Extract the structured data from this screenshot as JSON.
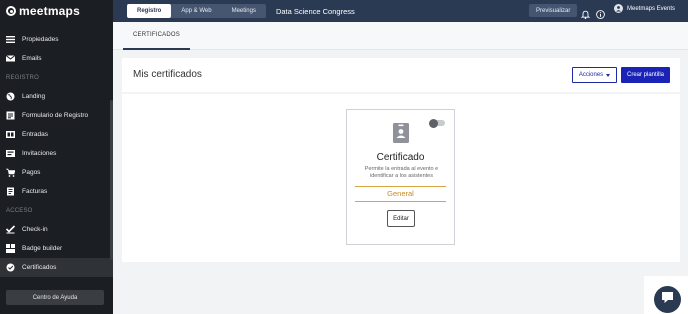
{
  "app": {
    "logo_text": "meetmaps"
  },
  "sidebar": {
    "items_top": [
      {
        "label": "Propiedades",
        "icon": "list-icon"
      },
      {
        "label": "Emails",
        "icon": "envelope-icon"
      }
    ],
    "section_registro": "REGISTRO",
    "items_registro": [
      {
        "label": "Landing",
        "icon": "globe-icon"
      },
      {
        "label": "Formulario de Registro",
        "icon": "form-icon"
      },
      {
        "label": "Entradas",
        "icon": "ticket-icon"
      },
      {
        "label": "Invitaciones",
        "icon": "invitation-icon"
      },
      {
        "label": "Pagos",
        "icon": "cart-icon"
      },
      {
        "label": "Facturas",
        "icon": "invoice-icon"
      }
    ],
    "section_acceso": "ACCESO",
    "items_acceso": [
      {
        "label": "Check-in",
        "icon": "checkin-icon"
      },
      {
        "label": "Badge builder",
        "icon": "badge-builder-icon"
      },
      {
        "label": "Certificados",
        "icon": "certificate-icon",
        "active": true
      }
    ],
    "help_label": "Centro de Ayuda"
  },
  "topbar": {
    "tabs": [
      "Registro",
      "App & Web",
      "Meetings"
    ],
    "active_tab": "Registro",
    "event_title": "Data Science Congress",
    "preview_label": "Previsualizar",
    "account_name": "Meetmaps Events"
  },
  "subtabs": {
    "active": "CERTIFICADOS"
  },
  "main": {
    "title": "Mis certificados",
    "actions_label": "Acciones",
    "create_label": "Crear plantilla"
  },
  "certificate_card": {
    "title": "Certificado",
    "description": "Permite la entrada al evento e identificar a los asistentes",
    "type": "General",
    "edit_label": "Editar",
    "enabled": false
  },
  "colors": {
    "sidebar_bg": "#1b1e23",
    "topbar_bg": "#2a3a53",
    "primary": "#1a23b5",
    "accent_gold": "#c98a22"
  }
}
